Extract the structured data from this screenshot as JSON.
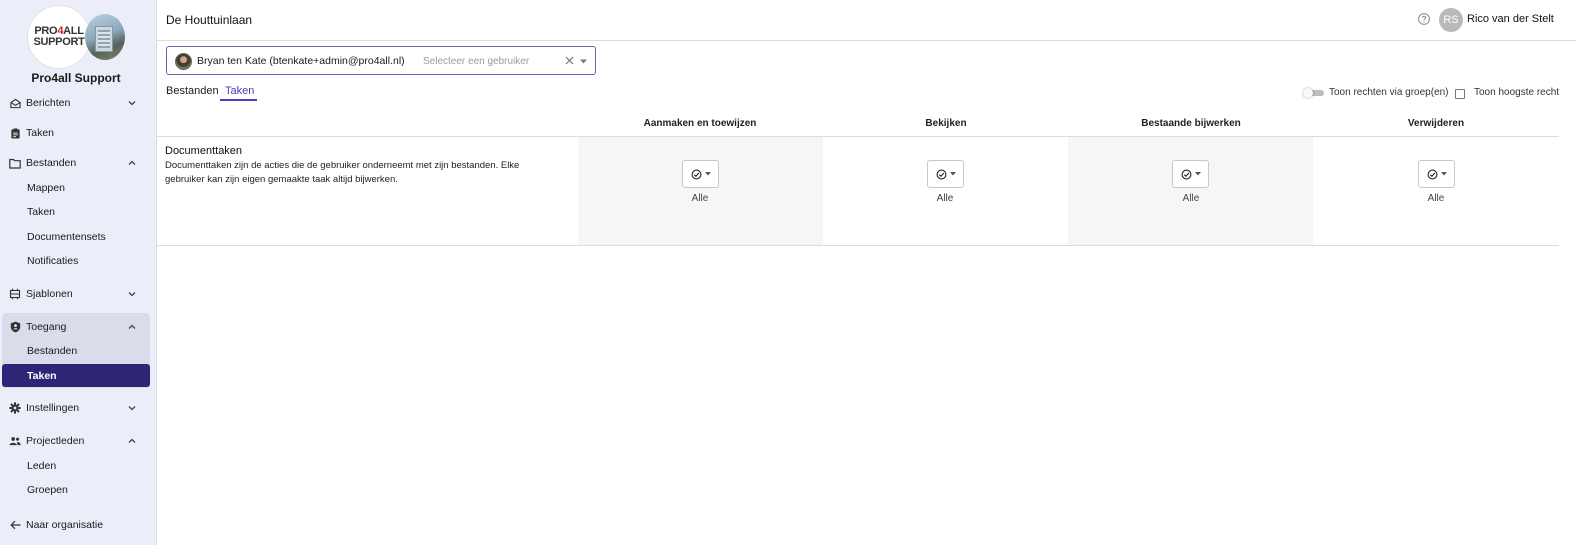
{
  "org": {
    "logo_text_line1_a": "PRO",
    "logo_text_line1_b": "4",
    "logo_text_line1_c": "ALL",
    "logo_text_line2": "SUPPORT",
    "name": "Pro4all Support"
  },
  "sidebar": {
    "items": [
      {
        "label": "Berichten",
        "icon": "mail-icon"
      },
      {
        "label": "Taken",
        "icon": "clipboard-icon"
      },
      {
        "label": "Bestanden",
        "icon": "folder-icon"
      },
      {
        "label": "Mappen"
      },
      {
        "label": "Taken"
      },
      {
        "label": "Documentensets"
      },
      {
        "label": "Notificaties"
      },
      {
        "label": "Sjablonen",
        "icon": "template-icon"
      },
      {
        "label": "Toegang",
        "icon": "shield-icon"
      },
      {
        "label": "Bestanden"
      },
      {
        "label": "Taken"
      },
      {
        "label": "Instellingen",
        "icon": "gear-icon"
      },
      {
        "label": "Projectleden",
        "icon": "people-icon"
      },
      {
        "label": "Leden"
      },
      {
        "label": "Groepen"
      },
      {
        "label": "Naar organisatie",
        "icon": "arrow-left-icon"
      }
    ],
    "active_color": "#2e2577"
  },
  "header": {
    "project_title": "De Houttuinlaan",
    "avatar_initials": "RS",
    "user_name": "Rico van der Stelt"
  },
  "user_select": {
    "selected_user": "Bryan ten Kate (btenkate+admin@pro4all.nl)",
    "placeholder": "Selecteer een gebruiker"
  },
  "tabs": [
    {
      "label": "Bestanden",
      "active": false
    },
    {
      "label": "Taken",
      "active": true
    }
  ],
  "options": {
    "toggle_label": "Toon rechten via groep(en)",
    "toggle_on": false,
    "checkbox_label": "Toon hoogste recht",
    "checkbox_checked": false
  },
  "table": {
    "columns": [
      "Aanmaken en toewijzen",
      "Bekijken",
      "Bestaande bijwerken",
      "Verwijderen"
    ],
    "rows": [
      {
        "title": "Documenttaken",
        "description": "Documenttaken zijn de acties die de gebruiker onderneemt met zijn bestanden. Elke gebruiker kan zijn eigen gemaakte taak altijd bijwerken.",
        "values": [
          "Alle",
          "Alle",
          "Alle",
          "Alle"
        ]
      }
    ]
  },
  "accent_color": "#4a40b3"
}
